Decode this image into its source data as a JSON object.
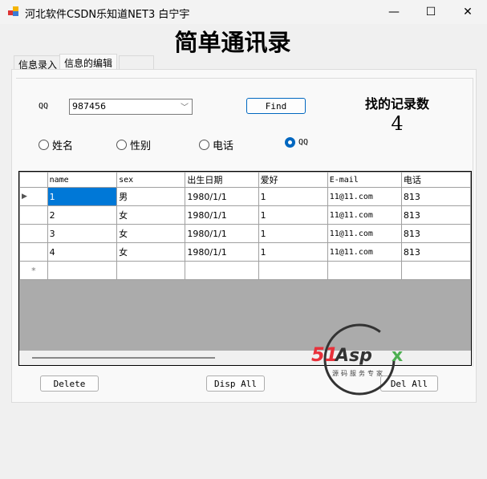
{
  "window": {
    "title": "河北软件CSDN乐知道NET3 白宁宇",
    "minimize": "—",
    "maximize": "☐",
    "close": "✕"
  },
  "heading": "简单通讯录",
  "tabs": [
    {
      "label": "信息录入"
    },
    {
      "label": "信息的编辑"
    }
  ],
  "search": {
    "label": "QQ",
    "value": "987456",
    "find_label": "Find",
    "chevron": "﹀"
  },
  "count": {
    "label": "找的记录数",
    "value": "4"
  },
  "radios": [
    {
      "label": "姓名",
      "checked": false
    },
    {
      "label": "性别",
      "checked": false
    },
    {
      "label": "电话",
      "checked": false
    },
    {
      "label": "QQ",
      "checked": true
    }
  ],
  "grid": {
    "columns": [
      "name",
      "sex",
      "出生日期",
      "爱好",
      "E-mail",
      "电话"
    ],
    "rows": [
      [
        "1",
        "男",
        "1980/1/1",
        "1",
        "11@11.com",
        "813"
      ],
      [
        "2",
        "女",
        "1980/1/1",
        "1",
        "11@11.com",
        "813"
      ],
      [
        "3",
        "女",
        "1980/1/1",
        "1",
        "11@11.com",
        "813"
      ],
      [
        "4",
        "女",
        "1980/1/1",
        "1",
        "11@11.com",
        "813"
      ]
    ],
    "current_marker": "▶",
    "new_marker": "*"
  },
  "buttons": {
    "delete": "Delete",
    "disp_all": "Disp All",
    "del_all": "Del All"
  },
  "watermark": {
    "brand": "51Aspx",
    "tagline": "源码服务专家"
  }
}
